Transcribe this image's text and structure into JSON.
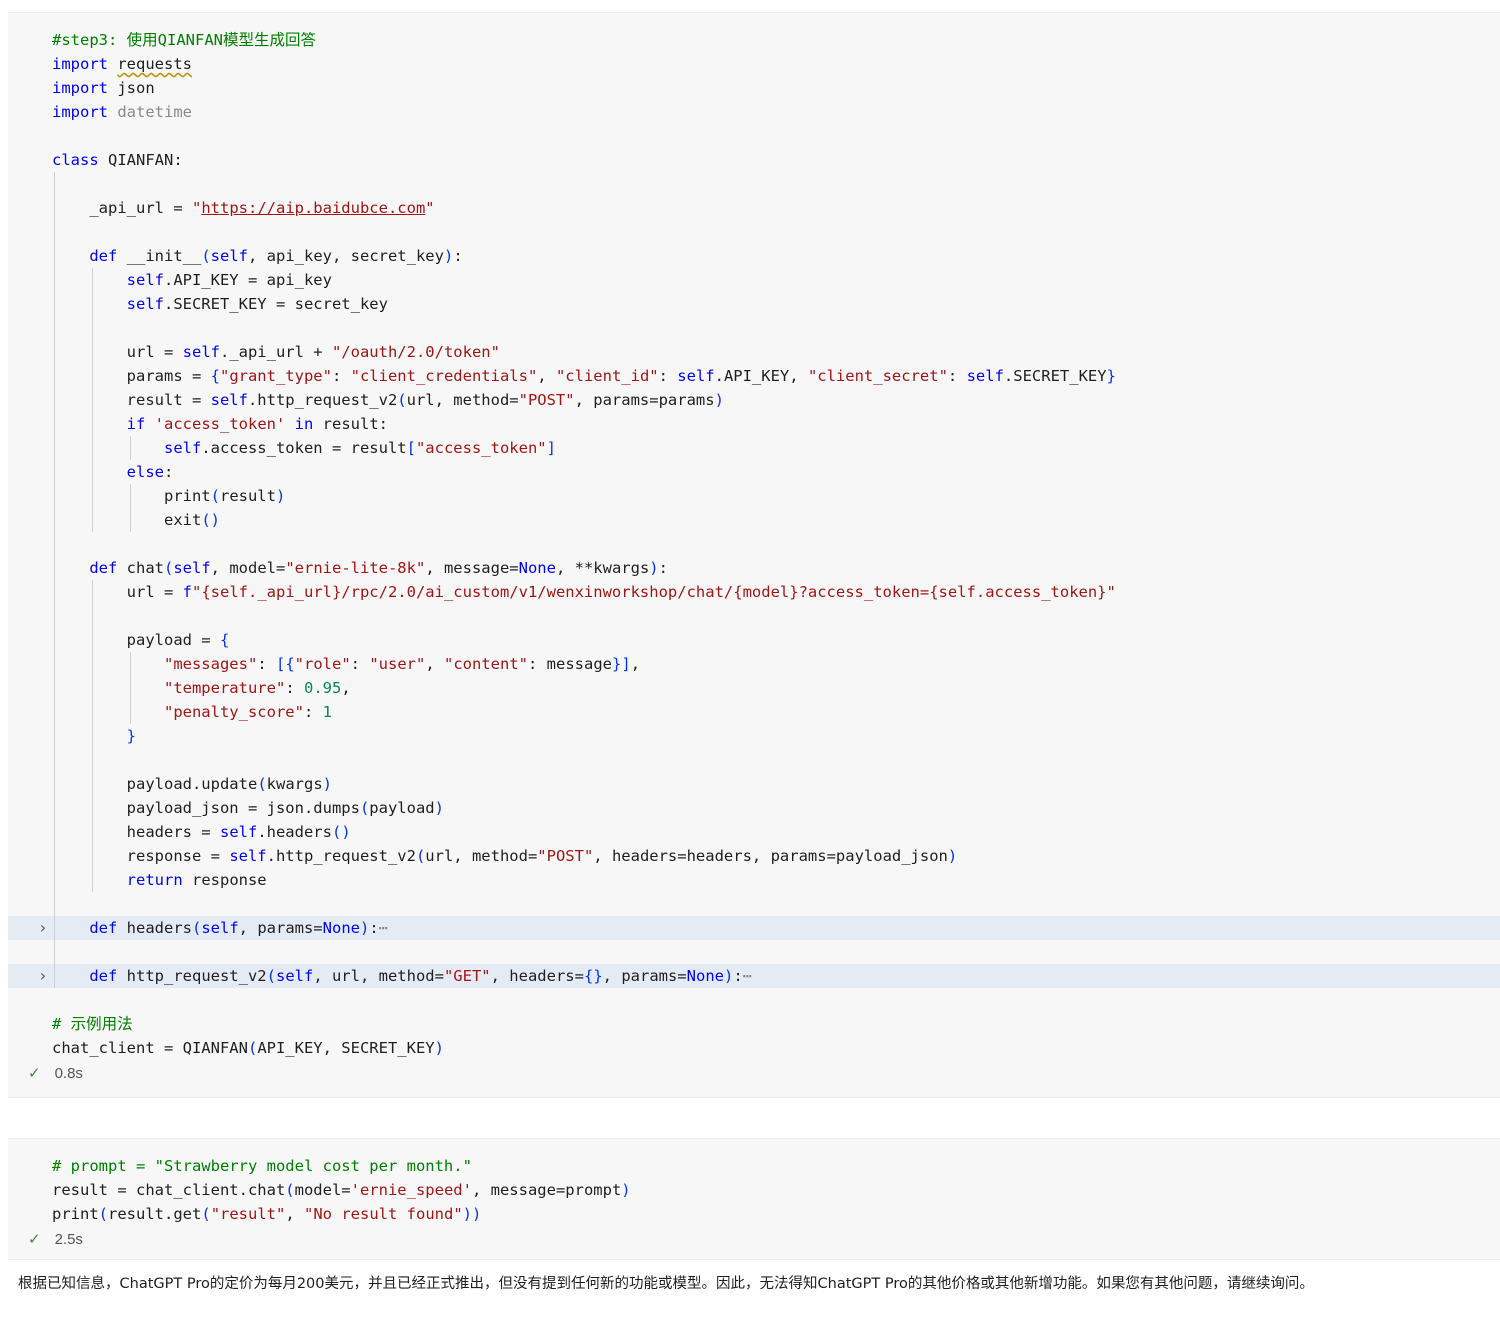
{
  "cell1": {
    "lines": [
      "#step3: 使用QIANFAN模型生成回答",
      "import requests",
      "import json",
      "import datetime",
      "",
      "class QIANFAN:",
      "",
      "    _api_url = \"https://aip.baidubce.com\"",
      "",
      "    def __init__(self, api_key, secret_key):",
      "        self.API_KEY = api_key",
      "        self.SECRET_KEY = secret_key",
      "",
      "        url = self._api_url + \"/oauth/2.0/token\"",
      "        params = {\"grant_type\": \"client_credentials\", \"client_id\": self.API_KEY, \"client_secret\": self.SECRET_KEY}",
      "        result = self.http_request_v2(url, method=\"POST\", params=params)",
      "        if 'access_token' in result:",
      "            self.access_token = result[\"access_token\"]",
      "        else:",
      "            print(result)",
      "            exit()",
      "",
      "    def chat(self, model=\"ernie-lite-8k\", message=None, **kwargs):",
      "        url = f\"{self._api_url}/rpc/2.0/ai_custom/v1/wenxinworkshop/chat/{model}?access_token={self.access_token}\"",
      "",
      "        payload = {",
      "            \"messages\": [{\"role\": \"user\", \"content\": message}],",
      "            \"temperature\": 0.95,",
      "            \"penalty_score\": 1",
      "        }",
      "",
      "        payload.update(kwargs)",
      "        payload_json = json.dumps(payload)",
      "        headers = self.headers()",
      "        response = self.http_request_v2(url, method=\"POST\", headers=headers, params=payload_json)",
      "        return response",
      "",
      "    def headers(self, params=None):⋯",
      "",
      "    def http_request_v2(self, url, method=\"GET\", headers={}, params=None):⋯",
      "",
      "# 示例用法",
      "chat_client = QIANFAN(API_KEY, SECRET_KEY)"
    ],
    "status_check": "✓",
    "status_time": "0.8s",
    "fold_icon": "chevron-right-icon"
  },
  "cell2": {
    "lines": [
      "# prompt = \"Strawberry model cost per month.\"",
      "result = chat_client.chat(model='ernie_speed', message=prompt)",
      "print(result.get(\"result\", \"No result found\"))"
    ],
    "status_check": "✓",
    "status_time": "2.5s"
  },
  "output": {
    "text": "根据已知信息，ChatGPT Pro的定价为每月200美元，并且已经正式推出，但没有提到任何新的功能或模型。因此，无法得知ChatGPT Pro的其他价格或其他新增功能。如果您有其他问题，请继续询问。"
  },
  "colors": {
    "keyword": "#0000ff",
    "string": "#a31515",
    "comment": "#008000",
    "number": "#098658",
    "cell_background": "#f7f7f7",
    "folded_line_highlight": "#e4ebf5",
    "success_check": "#3c8a3c"
  }
}
